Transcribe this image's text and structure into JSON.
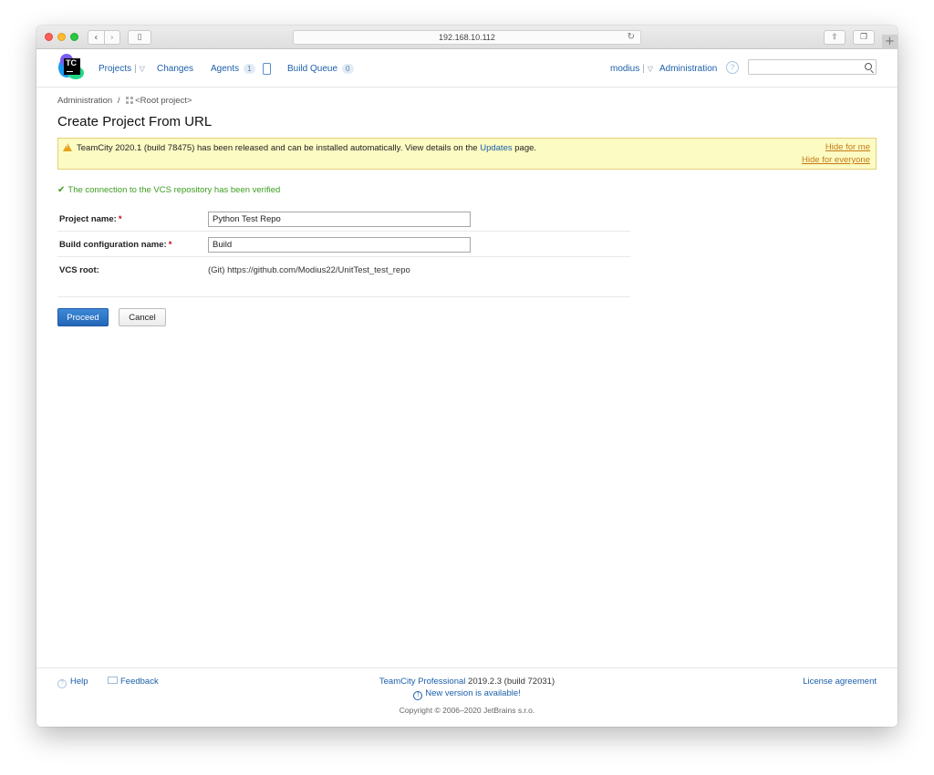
{
  "browser": {
    "url": "192.168.10.112"
  },
  "header": {
    "logo_text": "TC",
    "projects_label": "Projects",
    "changes_label": "Changes",
    "agents_label": "Agents",
    "agents_count": "1",
    "build_queue_label": "Build Queue",
    "build_queue_count": "0",
    "user_label": "modius",
    "administration_label": "Administration",
    "help_glyph": "?",
    "search_placeholder": ""
  },
  "breadcrumb": {
    "admin": "Administration",
    "separator": "/",
    "root": "<Root project>"
  },
  "page": {
    "title": "Create Project From URL"
  },
  "alert": {
    "message_before": "TeamCity 2020.1 (build 78475) has been released and can be installed automatically. View details on the ",
    "link": "Updates",
    "message_after": " page.",
    "hide_me": "Hide for me",
    "hide_everyone": "Hide for everyone",
    "icon": "warning-icon"
  },
  "verified": {
    "check": "✔",
    "text": "The connection to the VCS repository has been verified"
  },
  "form": {
    "project_name_label": "Project name:",
    "project_name_value": "Python Test Repo",
    "build_config_label": "Build configuration name:",
    "build_config_value": "Build",
    "vcs_root_label": "VCS root:",
    "vcs_root_value": "(Git) https://github.com/Modius22/UnitTest_test_repo",
    "required_mark": "*"
  },
  "buttons": {
    "proceed": "Proceed",
    "cancel": "Cancel"
  },
  "footer": {
    "help": "Help",
    "feedback": "Feedback",
    "product": "TeamCity Professional",
    "version": " 2019.2.3 (build 72031)",
    "new_version": "New version is available!",
    "copyright": "Copyright © 2006–2020 JetBrains s.r.o.",
    "license": "License agreement"
  }
}
